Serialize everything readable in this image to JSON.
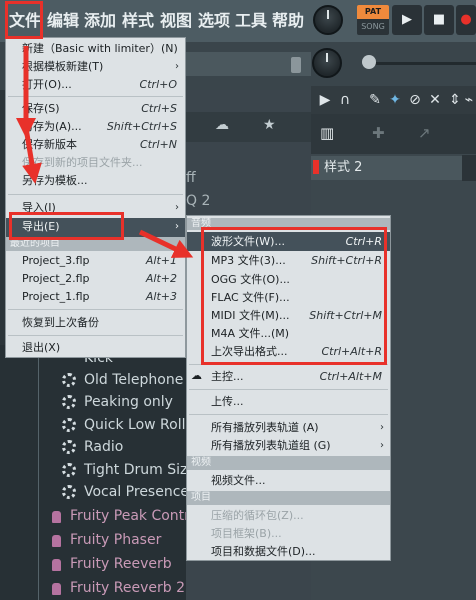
{
  "menubar": {
    "items": [
      "文件",
      "编辑",
      "添加",
      "样式",
      "视图",
      "选项",
      "工具",
      "帮助"
    ]
  },
  "transport": {
    "pat_label": "PAT",
    "song_label": "SONG",
    "play_icon": "play-icon",
    "stop_icon": "stop-icon",
    "record_icon": "record-icon"
  },
  "file_menu": {
    "items": [
      {
        "label": "新建（Basic with limiter）(N)",
        "shortcut": ""
      },
      {
        "label": "根据模板新建(T)",
        "shortcut": ""
      },
      {
        "label": "打开(O)...",
        "shortcut": "Ctrl+O"
      },
      {
        "label": "保存(S)",
        "shortcut": "Ctrl+S"
      },
      {
        "label": "另存为(A)...",
        "shortcut": "Shift+Ctrl+S"
      },
      {
        "label": "保存新版本",
        "shortcut": "Ctrl+N"
      },
      {
        "label": "保存到新的项目文件夹...",
        "shortcut": ""
      },
      {
        "label": "另存为模板...",
        "shortcut": ""
      },
      {
        "label": "导入(I)",
        "shortcut": ""
      },
      {
        "label": "导出(E)",
        "shortcut": ""
      },
      {
        "label": "Project_3.flp",
        "shortcut": "Alt+1"
      },
      {
        "label": "Project_2.flp",
        "shortcut": "Alt+2"
      },
      {
        "label": "Project_1.flp",
        "shortcut": "Alt+3"
      },
      {
        "label": "恢复到上次备份",
        "shortcut": ""
      },
      {
        "label": "退出(X)",
        "shortcut": ""
      }
    ],
    "recent_section": "最近的项目"
  },
  "export_menu": {
    "items": [
      {
        "label": "波形文件(W)...",
        "shortcut": "Ctrl+R"
      },
      {
        "label": "MP3 文件(3)...",
        "shortcut": "Shift+Ctrl+R"
      },
      {
        "label": "OGG 文件(O)...",
        "shortcut": ""
      },
      {
        "label": "FLAC 文件(F)...",
        "shortcut": ""
      },
      {
        "label": "MIDI 文件(M)...",
        "shortcut": "Shift+Ctrl+M"
      },
      {
        "label": "M4A 文件...(M)",
        "shortcut": ""
      },
      {
        "label": "上次导出格式...",
        "shortcut": "Ctrl+Alt+R"
      },
      {
        "label": "主控...",
        "shortcut": "Ctrl+Alt+M"
      },
      {
        "label": "上传...",
        "shortcut": ""
      },
      {
        "label": "所有播放列表轨道 (A)",
        "shortcut": ""
      },
      {
        "label": "所有播放列表轨道组 (G)",
        "shortcut": ""
      },
      {
        "label": "视频文件...",
        "shortcut": ""
      },
      {
        "label": "压缩的循环包(Z)...",
        "shortcut": ""
      },
      {
        "label": "项目框架(B)...",
        "shortcut": ""
      },
      {
        "label": "项目和数据文件(D)...",
        "shortcut": ""
      }
    ],
    "top_section": "音频",
    "video_section": "视频",
    "project_section": "项目"
  },
  "browser": {
    "partial_text_1": "ff",
    "partial_text_2": "Q 2",
    "plugins": [
      "Kick",
      "Old Telephone",
      "Peaking only",
      "Quick Low Roll-Off",
      "Radio",
      "Tight Drum Sizzle",
      "Vocal Presence"
    ],
    "fruity": [
      "Fruity Peak Controller",
      "Fruity Phaser",
      "Fruity Reeverb",
      "Fruity Reeverb 2"
    ]
  },
  "playlist": {
    "pattern_label": "样式 2"
  },
  "colors": {
    "annotation_red": "#e8312a",
    "menu_bg": "#dde2e5",
    "highlight_bg": "#44515a"
  }
}
